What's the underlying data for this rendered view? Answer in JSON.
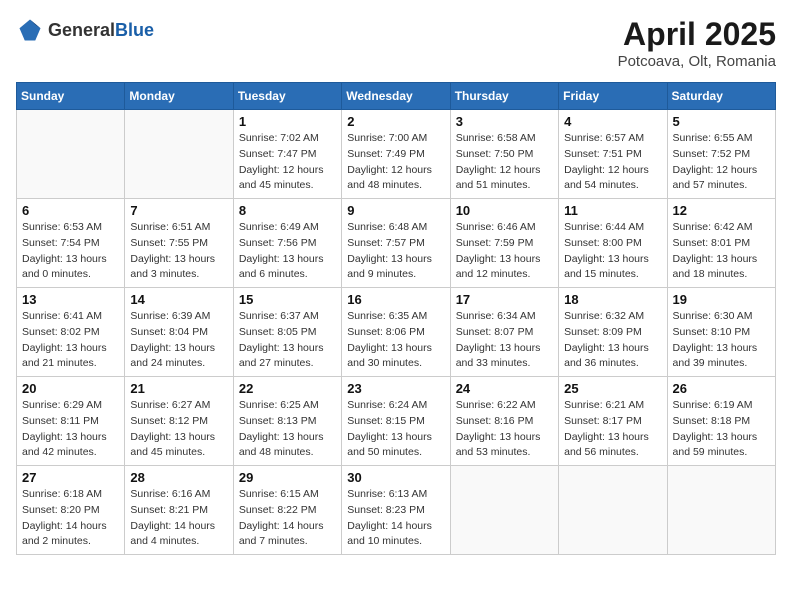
{
  "header": {
    "logo_general": "General",
    "logo_blue": "Blue",
    "month": "April 2025",
    "location": "Potcoava, Olt, Romania"
  },
  "weekdays": [
    "Sunday",
    "Monday",
    "Tuesday",
    "Wednesday",
    "Thursday",
    "Friday",
    "Saturday"
  ],
  "weeks": [
    [
      {
        "day": "",
        "sunrise": "",
        "sunset": "",
        "daylight": ""
      },
      {
        "day": "",
        "sunrise": "",
        "sunset": "",
        "daylight": ""
      },
      {
        "day": "1",
        "sunrise": "Sunrise: 7:02 AM",
        "sunset": "Sunset: 7:47 PM",
        "daylight": "Daylight: 12 hours and 45 minutes."
      },
      {
        "day": "2",
        "sunrise": "Sunrise: 7:00 AM",
        "sunset": "Sunset: 7:49 PM",
        "daylight": "Daylight: 12 hours and 48 minutes."
      },
      {
        "day": "3",
        "sunrise": "Sunrise: 6:58 AM",
        "sunset": "Sunset: 7:50 PM",
        "daylight": "Daylight: 12 hours and 51 minutes."
      },
      {
        "day": "4",
        "sunrise": "Sunrise: 6:57 AM",
        "sunset": "Sunset: 7:51 PM",
        "daylight": "Daylight: 12 hours and 54 minutes."
      },
      {
        "day": "5",
        "sunrise": "Sunrise: 6:55 AM",
        "sunset": "Sunset: 7:52 PM",
        "daylight": "Daylight: 12 hours and 57 minutes."
      }
    ],
    [
      {
        "day": "6",
        "sunrise": "Sunrise: 6:53 AM",
        "sunset": "Sunset: 7:54 PM",
        "daylight": "Daylight: 13 hours and 0 minutes."
      },
      {
        "day": "7",
        "sunrise": "Sunrise: 6:51 AM",
        "sunset": "Sunset: 7:55 PM",
        "daylight": "Daylight: 13 hours and 3 minutes."
      },
      {
        "day": "8",
        "sunrise": "Sunrise: 6:49 AM",
        "sunset": "Sunset: 7:56 PM",
        "daylight": "Daylight: 13 hours and 6 minutes."
      },
      {
        "day": "9",
        "sunrise": "Sunrise: 6:48 AM",
        "sunset": "Sunset: 7:57 PM",
        "daylight": "Daylight: 13 hours and 9 minutes."
      },
      {
        "day": "10",
        "sunrise": "Sunrise: 6:46 AM",
        "sunset": "Sunset: 7:59 PM",
        "daylight": "Daylight: 13 hours and 12 minutes."
      },
      {
        "day": "11",
        "sunrise": "Sunrise: 6:44 AM",
        "sunset": "Sunset: 8:00 PM",
        "daylight": "Daylight: 13 hours and 15 minutes."
      },
      {
        "day": "12",
        "sunrise": "Sunrise: 6:42 AM",
        "sunset": "Sunset: 8:01 PM",
        "daylight": "Daylight: 13 hours and 18 minutes."
      }
    ],
    [
      {
        "day": "13",
        "sunrise": "Sunrise: 6:41 AM",
        "sunset": "Sunset: 8:02 PM",
        "daylight": "Daylight: 13 hours and 21 minutes."
      },
      {
        "day": "14",
        "sunrise": "Sunrise: 6:39 AM",
        "sunset": "Sunset: 8:04 PM",
        "daylight": "Daylight: 13 hours and 24 minutes."
      },
      {
        "day": "15",
        "sunrise": "Sunrise: 6:37 AM",
        "sunset": "Sunset: 8:05 PM",
        "daylight": "Daylight: 13 hours and 27 minutes."
      },
      {
        "day": "16",
        "sunrise": "Sunrise: 6:35 AM",
        "sunset": "Sunset: 8:06 PM",
        "daylight": "Daylight: 13 hours and 30 minutes."
      },
      {
        "day": "17",
        "sunrise": "Sunrise: 6:34 AM",
        "sunset": "Sunset: 8:07 PM",
        "daylight": "Daylight: 13 hours and 33 minutes."
      },
      {
        "day": "18",
        "sunrise": "Sunrise: 6:32 AM",
        "sunset": "Sunset: 8:09 PM",
        "daylight": "Daylight: 13 hours and 36 minutes."
      },
      {
        "day": "19",
        "sunrise": "Sunrise: 6:30 AM",
        "sunset": "Sunset: 8:10 PM",
        "daylight": "Daylight: 13 hours and 39 minutes."
      }
    ],
    [
      {
        "day": "20",
        "sunrise": "Sunrise: 6:29 AM",
        "sunset": "Sunset: 8:11 PM",
        "daylight": "Daylight: 13 hours and 42 minutes."
      },
      {
        "day": "21",
        "sunrise": "Sunrise: 6:27 AM",
        "sunset": "Sunset: 8:12 PM",
        "daylight": "Daylight: 13 hours and 45 minutes."
      },
      {
        "day": "22",
        "sunrise": "Sunrise: 6:25 AM",
        "sunset": "Sunset: 8:13 PM",
        "daylight": "Daylight: 13 hours and 48 minutes."
      },
      {
        "day": "23",
        "sunrise": "Sunrise: 6:24 AM",
        "sunset": "Sunset: 8:15 PM",
        "daylight": "Daylight: 13 hours and 50 minutes."
      },
      {
        "day": "24",
        "sunrise": "Sunrise: 6:22 AM",
        "sunset": "Sunset: 8:16 PM",
        "daylight": "Daylight: 13 hours and 53 minutes."
      },
      {
        "day": "25",
        "sunrise": "Sunrise: 6:21 AM",
        "sunset": "Sunset: 8:17 PM",
        "daylight": "Daylight: 13 hours and 56 minutes."
      },
      {
        "day": "26",
        "sunrise": "Sunrise: 6:19 AM",
        "sunset": "Sunset: 8:18 PM",
        "daylight": "Daylight: 13 hours and 59 minutes."
      }
    ],
    [
      {
        "day": "27",
        "sunrise": "Sunrise: 6:18 AM",
        "sunset": "Sunset: 8:20 PM",
        "daylight": "Daylight: 14 hours and 2 minutes."
      },
      {
        "day": "28",
        "sunrise": "Sunrise: 6:16 AM",
        "sunset": "Sunset: 8:21 PM",
        "daylight": "Daylight: 14 hours and 4 minutes."
      },
      {
        "day": "29",
        "sunrise": "Sunrise: 6:15 AM",
        "sunset": "Sunset: 8:22 PM",
        "daylight": "Daylight: 14 hours and 7 minutes."
      },
      {
        "day": "30",
        "sunrise": "Sunrise: 6:13 AM",
        "sunset": "Sunset: 8:23 PM",
        "daylight": "Daylight: 14 hours and 10 minutes."
      },
      {
        "day": "",
        "sunrise": "",
        "sunset": "",
        "daylight": ""
      },
      {
        "day": "",
        "sunrise": "",
        "sunset": "",
        "daylight": ""
      },
      {
        "day": "",
        "sunrise": "",
        "sunset": "",
        "daylight": ""
      }
    ]
  ]
}
